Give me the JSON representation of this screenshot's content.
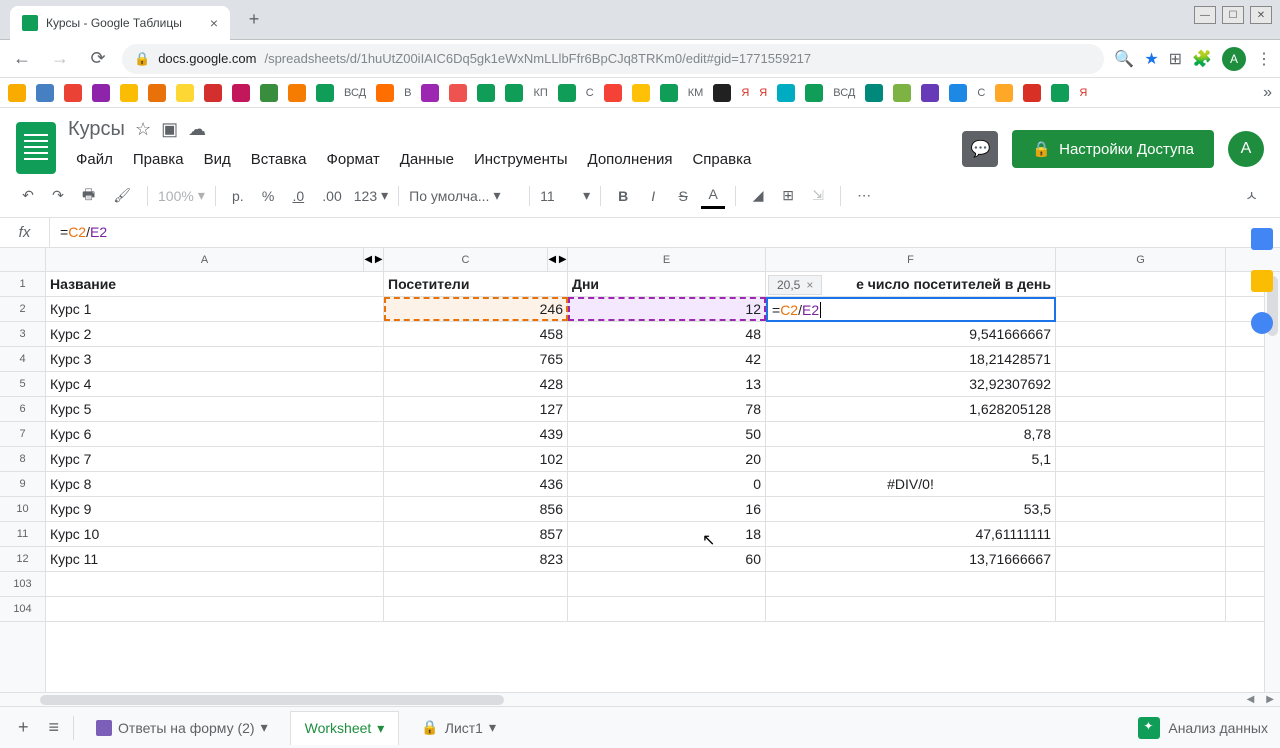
{
  "browser": {
    "tab_title": "Курсы - Google Таблицы",
    "url_host": "docs.google.com",
    "url_path": "/spreadsheets/d/1huUtZ00iIAIC6Dq5gk1eWxNmLLlbFfr6BpCJq8TRKm0/edit#gid=1771559217"
  },
  "doc": {
    "title": "Курсы",
    "menus": [
      "Файл",
      "Правка",
      "Вид",
      "Вставка",
      "Формат",
      "Данные",
      "Инструменты",
      "Дополнения",
      "Справка"
    ],
    "share_label": "Настройки Доступа",
    "avatar": "А"
  },
  "toolbar": {
    "zoom": "100%",
    "currency": "р.",
    "percent": "%",
    "dec_minus": ".0",
    "dec_plus": ".00",
    "format": "123",
    "font": "По умолча...",
    "size": "11"
  },
  "formula_bar": {
    "value": "=C2/E2"
  },
  "columns": {
    "A": "A",
    "C": "C",
    "E": "E",
    "F": "F",
    "G": "G"
  },
  "headers": {
    "name": "Название",
    "visitors": "Посетители",
    "days": "Дни",
    "avg": "е число посетителей в день"
  },
  "rows": [
    {
      "n": "1"
    },
    {
      "n": "2",
      "name": "Курс 1",
      "v": "246",
      "d": "12",
      "avg": ""
    },
    {
      "n": "3",
      "name": "Курс 2",
      "v": "458",
      "d": "48",
      "avg": "9,541666667"
    },
    {
      "n": "4",
      "name": "Курс 3",
      "v": "765",
      "d": "42",
      "avg": "18,21428571"
    },
    {
      "n": "5",
      "name": "Курс 4",
      "v": "428",
      "d": "13",
      "avg": "32,92307692"
    },
    {
      "n": "6",
      "name": "Курс 5",
      "v": "127",
      "d": "78",
      "avg": "1,628205128"
    },
    {
      "n": "7",
      "name": "Курс 6",
      "v": "439",
      "d": "50",
      "avg": "8,78"
    },
    {
      "n": "8",
      "name": "Курс 7",
      "v": "102",
      "d": "20",
      "avg": "5,1"
    },
    {
      "n": "9",
      "name": "Курс 8",
      "v": "436",
      "d": "0",
      "avg": "#DIV/0!"
    },
    {
      "n": "10",
      "name": "Курс 9",
      "v": "856",
      "d": "16",
      "avg": "53,5"
    },
    {
      "n": "11",
      "name": "Курс 10",
      "v": "857",
      "d": "18",
      "avg": "47,61111111"
    },
    {
      "n": "12",
      "name": "Курс 11",
      "v": "823",
      "d": "60",
      "avg": "13,71666667"
    },
    {
      "n": "103"
    },
    {
      "n": "104"
    }
  ],
  "active": {
    "tooltip": "20,5",
    "formula_eq": "=",
    "formula_c": "C2",
    "formula_op": "/",
    "formula_e": "E2"
  },
  "sheets": {
    "add": "+",
    "list": "≡",
    "tab1": "Ответы на форму (2)",
    "tab2": "Worksheet",
    "tab3": "Лист1",
    "explore": "Анализ данных"
  },
  "bookmark_labels": {
    "vsd": "ВСД",
    "v": "В",
    "kp": "КП",
    "s": "С",
    "km": "КМ",
    "ya": "Я",
    "vsd2": "ВСД",
    "s2": "С",
    "ya2": "Я"
  }
}
